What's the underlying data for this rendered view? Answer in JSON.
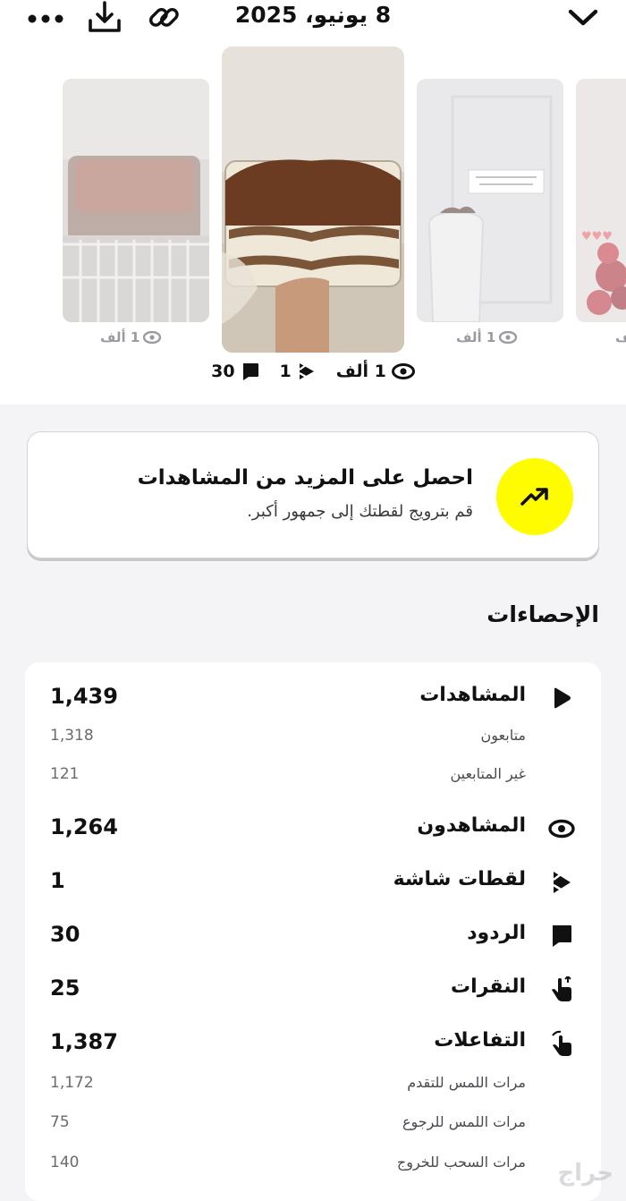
{
  "header": {
    "date": "8 يونيو، 2025",
    "icons": [
      "more-icon",
      "download-icon",
      "link-icon",
      "chevron-down-icon"
    ]
  },
  "thumbnails": [
    {
      "name": "fridge-cake",
      "views": "1 ألف"
    },
    {
      "name": "tiramisu-current"
    },
    {
      "name": "vase-plant",
      "views": "1 ألف"
    },
    {
      "name": "roses",
      "views": "ألف"
    }
  ],
  "current_story": {
    "views": "1 ألف",
    "screenshots": "1",
    "replies": "30"
  },
  "promo": {
    "title": "احصل على المزيد من المشاهدات",
    "subtitle": "قم بترويج لقطتك إلى جمهور أكبر.",
    "accent": "#fffc00"
  },
  "stats": {
    "title": "الإحصاءات",
    "views": {
      "label": "المشاهدات",
      "value": "1,439"
    },
    "followers": {
      "label": "متابعون",
      "value": "1,318"
    },
    "non_followers": {
      "label": "غير المتابعين",
      "value": "121"
    },
    "viewers": {
      "label": "المشاهدون",
      "value": "1,264"
    },
    "screenshots": {
      "label": "لقطات شاشة",
      "value": "1"
    },
    "replies": {
      "label": "الردود",
      "value": "30"
    },
    "taps": {
      "label": "النقرات",
      "value": "25"
    },
    "interactions": {
      "label": "التفاعلات",
      "value": "1,387"
    },
    "tap_forward": {
      "label": "مرات اللمس للتقدم",
      "value": "1,172"
    },
    "tap_back": {
      "label": "مرات اللمس للرجوع",
      "value": "75"
    },
    "swipe_exit": {
      "label": "مرات السحب للخروج",
      "value": "140"
    }
  },
  "watermark": "حراج"
}
